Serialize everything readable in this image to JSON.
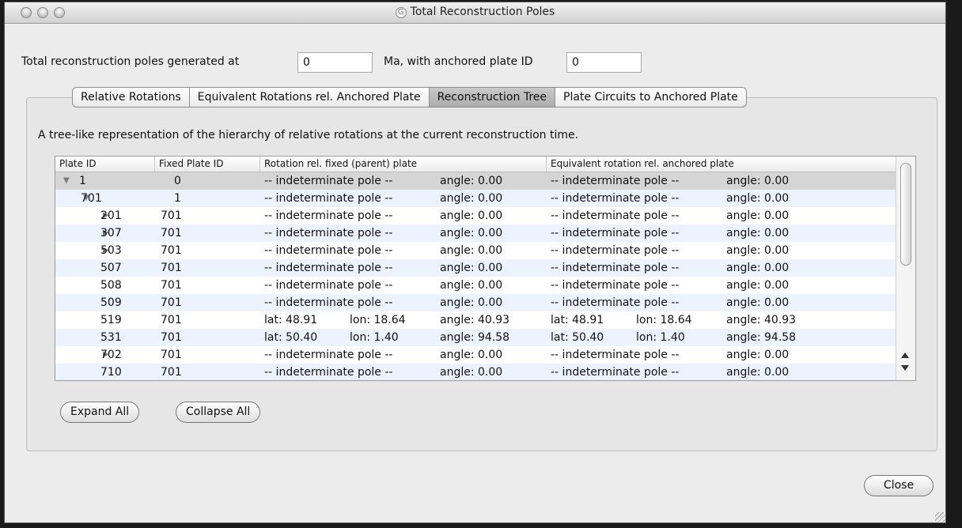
{
  "window": {
    "title": "Total Reconstruction Poles",
    "app_icon": "G"
  },
  "params": {
    "label_generated": "Total reconstruction poles generated at",
    "time_value": "0",
    "label_anchor": "Ma, with anchored plate ID",
    "anchor_value": "0"
  },
  "tabs": [
    {
      "label": "Relative Rotations",
      "active": false
    },
    {
      "label": "Equivalent Rotations rel. Anchored Plate",
      "active": false
    },
    {
      "label": "Reconstruction Tree",
      "active": true
    },
    {
      "label": "Plate Circuits to Anchored Plate",
      "active": false
    }
  ],
  "description": "A tree-like representation of the hierarchy of relative rotations at the current reconstruction time.",
  "table": {
    "headers": [
      "Plate ID",
      "Fixed Plate ID",
      "Rotation rel. fixed (parent) plate",
      "Equivalent rotation rel. anchored plate"
    ],
    "rows": [
      {
        "depth": 0,
        "toggle": "expanded",
        "plate": "1",
        "fixed": "0",
        "rel": [
          "-- indeterminate pole --",
          "",
          "angle: 0.00"
        ],
        "eq": [
          "-- indeterminate pole --",
          "",
          "angle: 0.00"
        ]
      },
      {
        "depth": 1,
        "toggle": "expanded",
        "plate": "701",
        "fixed": "1",
        "rel": [
          "-- indeterminate pole --",
          "",
          "angle: 0.00"
        ],
        "eq": [
          "-- indeterminate pole --",
          "",
          "angle: 0.00"
        ]
      },
      {
        "depth": 2,
        "toggle": "collapsed",
        "plate": "201",
        "fixed": "701",
        "rel": [
          "-- indeterminate pole --",
          "",
          "angle: 0.00"
        ],
        "eq": [
          "-- indeterminate pole --",
          "",
          "angle: 0.00"
        ]
      },
      {
        "depth": 2,
        "toggle": "collapsed",
        "plate": "307",
        "fixed": "701",
        "rel": [
          "-- indeterminate pole --",
          "",
          "angle: 0.00"
        ],
        "eq": [
          "-- indeterminate pole --",
          "",
          "angle: 0.00"
        ]
      },
      {
        "depth": 2,
        "toggle": "collapsed",
        "plate": "503",
        "fixed": "701",
        "rel": [
          "-- indeterminate pole --",
          "",
          "angle: 0.00"
        ],
        "eq": [
          "-- indeterminate pole --",
          "",
          "angle: 0.00"
        ]
      },
      {
        "depth": 2,
        "toggle": "none",
        "plate": "507",
        "fixed": "701",
        "rel": [
          "-- indeterminate pole --",
          "",
          "angle: 0.00"
        ],
        "eq": [
          "-- indeterminate pole --",
          "",
          "angle: 0.00"
        ]
      },
      {
        "depth": 2,
        "toggle": "none",
        "plate": "508",
        "fixed": "701",
        "rel": [
          "-- indeterminate pole --",
          "",
          "angle: 0.00"
        ],
        "eq": [
          "-- indeterminate pole --",
          "",
          "angle: 0.00"
        ]
      },
      {
        "depth": 2,
        "toggle": "none",
        "plate": "509",
        "fixed": "701",
        "rel": [
          "-- indeterminate pole --",
          "",
          "angle: 0.00"
        ],
        "eq": [
          "-- indeterminate pole --",
          "",
          "angle: 0.00"
        ]
      },
      {
        "depth": 2,
        "toggle": "none",
        "plate": "519",
        "fixed": "701",
        "rel": [
          "lat: 48.91",
          "lon: 18.64",
          "angle: 40.93"
        ],
        "eq": [
          "lat: 48.91",
          "lon: 18.64",
          "angle: 40.93"
        ]
      },
      {
        "depth": 2,
        "toggle": "none",
        "plate": "531",
        "fixed": "701",
        "rel": [
          "lat: 50.40",
          "lon: 1.40",
          "angle: 94.58"
        ],
        "eq": [
          "lat: 50.40",
          "lon: 1.40",
          "angle: 94.58"
        ]
      },
      {
        "depth": 2,
        "toggle": "collapsed",
        "plate": "702",
        "fixed": "701",
        "rel": [
          "-- indeterminate pole --",
          "",
          "angle: 0.00"
        ],
        "eq": [
          "-- indeterminate pole --",
          "",
          "angle: 0.00"
        ]
      },
      {
        "depth": 2,
        "toggle": "none",
        "plate": "710",
        "fixed": "701",
        "rel": [
          "-- indeterminate pole --",
          "",
          "angle: 0.00"
        ],
        "eq": [
          "-- indeterminate pole --",
          "",
          "angle: 0.00"
        ]
      }
    ]
  },
  "buttons": {
    "expand_all": "Expand All",
    "collapse_all": "Collapse All",
    "close": "Close"
  }
}
